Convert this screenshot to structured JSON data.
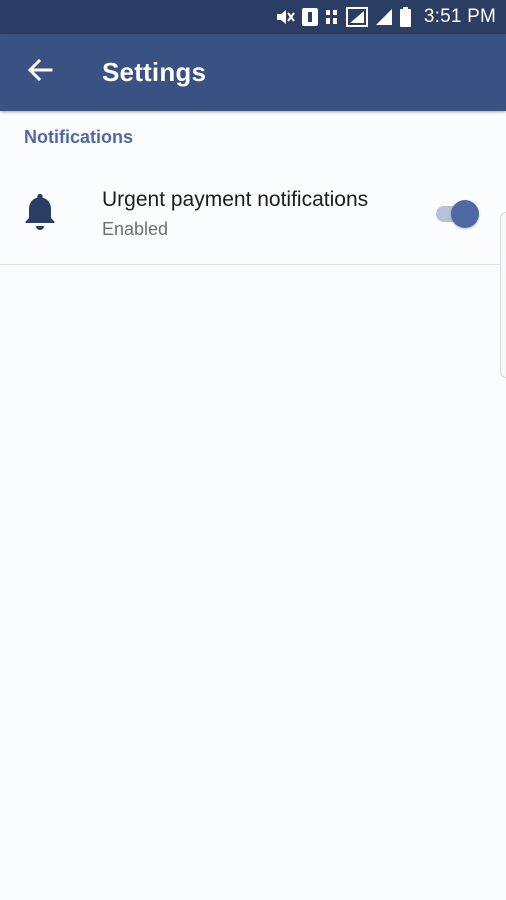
{
  "status_bar": {
    "time": "3:51 PM",
    "icons": [
      "mute-icon",
      "notification-badge-icon",
      "data-icon",
      "wifi-signal-icon",
      "cell-signal-icon",
      "battery-icon"
    ]
  },
  "app_bar": {
    "title": "Settings",
    "back_icon": "arrow-left-icon"
  },
  "section": {
    "header": "Notifications"
  },
  "setting": {
    "icon": "bell-icon",
    "title": "Urgent payment notifications",
    "summary": "Enabled",
    "enabled": true
  },
  "colors": {
    "status_bar": "#2b3d63",
    "app_bar": "#3a5283",
    "accent": "#4f6aa3",
    "background": "#fbfcfe"
  }
}
